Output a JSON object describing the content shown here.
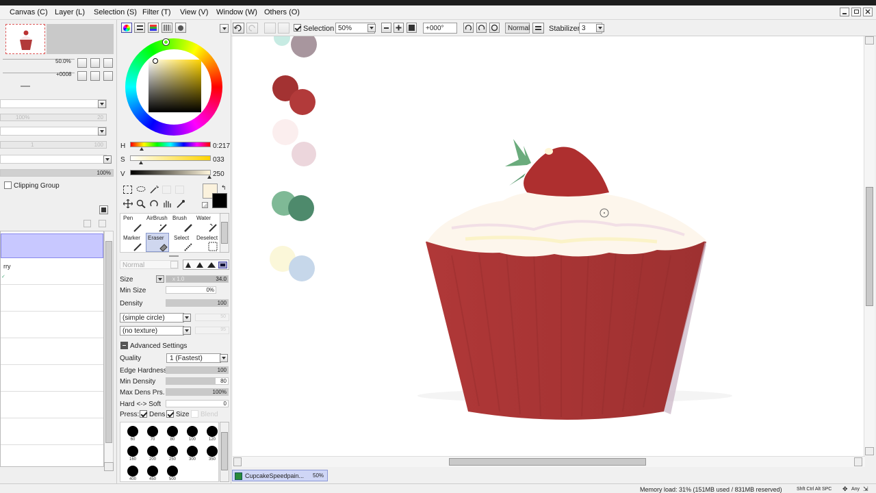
{
  "menu": {
    "canvas": "Canvas (C)",
    "layer": "Layer (L)",
    "selection": "Selection (S)",
    "filter": "Filter (T)",
    "view": "View (V)",
    "window": "Window (W)",
    "others": "Others (O)"
  },
  "toolbar": {
    "selection_label": "Selection",
    "selection_checked": true,
    "zoom": "50%",
    "rotation": "+000°",
    "blend_mode": "Normal",
    "stabilizer_label": "Stabilizer",
    "stabilizer_value": "3"
  },
  "navigator": {
    "zoom": "50.0%",
    "angle": "+0008"
  },
  "layers": {
    "opacity": "100%",
    "clipping_label": "Clipping Group",
    "item_partial": "rry",
    "slider_a": "100%",
    "slider_b": "20",
    "slider_c": "1",
    "slider_d": "100"
  },
  "color": {
    "h_label": "H",
    "h_value": "0:217",
    "s_label": "S",
    "s_value": "033",
    "v_label": "V",
    "v_value": "250",
    "primary": "#fbf2dd",
    "secondary": "#000000"
  },
  "tools": {
    "pen": "Pen",
    "airbrush": "AirBrush",
    "brush": "Brush",
    "water": "Water",
    "marker": "Marker",
    "eraser": "Eraser",
    "select": "Select",
    "deselect": "Deselect"
  },
  "tool_settings": {
    "mode": "Normal",
    "size_label": "Size",
    "size_mult": "x 1.0",
    "size_value": "34.0",
    "min_size_label": "Min Size",
    "min_size_value": "0%",
    "min_size_level": 0,
    "density_label": "Density",
    "density_value": "100",
    "density_level": 1,
    "shape": "(simple circle)",
    "shape_value": "50",
    "texture": "(no texture)",
    "texture_value": "95",
    "advanced_label": "Advanced Settings",
    "quality_label": "Quality",
    "quality_value": "1 (Fastest)",
    "edge_label": "Edge Hardness",
    "edge_value": "100",
    "edge_level": 1,
    "min_density_label": "Min Density",
    "min_density_value": "80",
    "min_density_level": 0.8,
    "max_dens_label": "Max Dens Prs.",
    "max_dens_value": "100%",
    "max_dens_level": 1,
    "hard_soft_label": "Hard <-> Soft",
    "hard_soft_value": "0",
    "hard_soft_level": 0,
    "press_label": "Press:",
    "dens_label": "Dens",
    "size_chk_label": "Size",
    "blend_label": "Blend"
  },
  "brush_sizes": [
    "60",
    "70",
    "80",
    "100",
    "120",
    "160",
    "200",
    "250",
    "300",
    "350",
    "400",
    "450",
    "500"
  ],
  "palette": {
    "swatches": [
      "#a8969e",
      "#a33232",
      "#b23a3a",
      "#fbeeee",
      "#ecd6dc",
      "#7fb996",
      "#4e8a6c",
      "#fbf7d9",
      "#c6d7ea",
      "#c7ebe3"
    ]
  },
  "document_tab": {
    "name": "CupcakeSpeedpain...",
    "zoom": "50%"
  },
  "status": {
    "memory": "Memory load: 31% (151MB used / 831MB reserved)",
    "keys": "Shft Ctrl Alt SPC",
    "any": "Any"
  }
}
